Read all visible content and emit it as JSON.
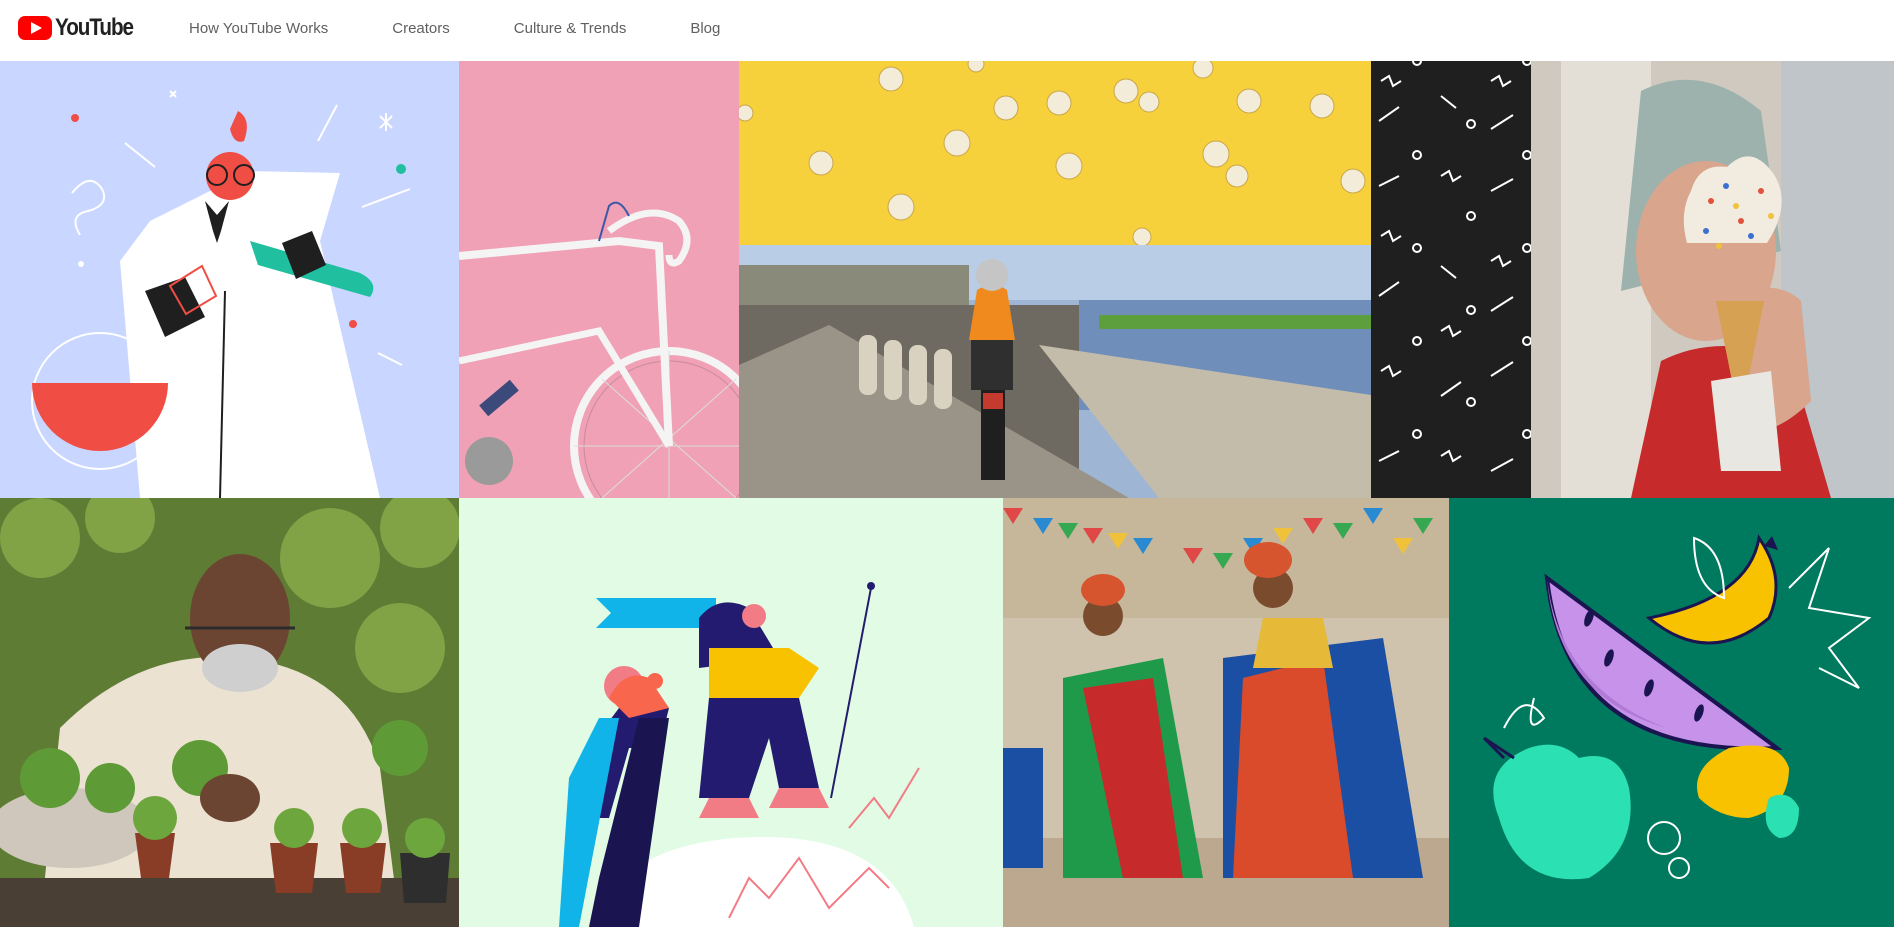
{
  "brand": {
    "logo_text": "YouTube"
  },
  "nav": {
    "items": [
      {
        "label": "How YouTube Works"
      },
      {
        "label": "Creators"
      },
      {
        "label": "Culture & Trends"
      },
      {
        "label": "Blog"
      }
    ]
  },
  "colors": {
    "brand_red": "#ff0000",
    "nav_text": "#606060",
    "scientist_bg": "#c9d6ff",
    "bike_bg": "#f0a1b5",
    "popcorn_bg": "#f7d13c",
    "pattern_bg": "#1f1f1f",
    "hiker_bg": "#e1fbe4",
    "fruit_bg": "#007a5e"
  },
  "mosaic": [
    {
      "icon": "scientist-illustration"
    },
    {
      "icon": "pink-bicycle-photo"
    },
    {
      "icon": "popcorn-photo"
    },
    {
      "icon": "motorcycle-riverside-photo"
    },
    {
      "icon": "squiggle-pattern"
    },
    {
      "icon": "ice-cream-photo"
    },
    {
      "icon": "gardener-photo"
    },
    {
      "icon": "hikers-illustration"
    },
    {
      "icon": "dancers-photo"
    },
    {
      "icon": "fruit-illustration"
    }
  ]
}
